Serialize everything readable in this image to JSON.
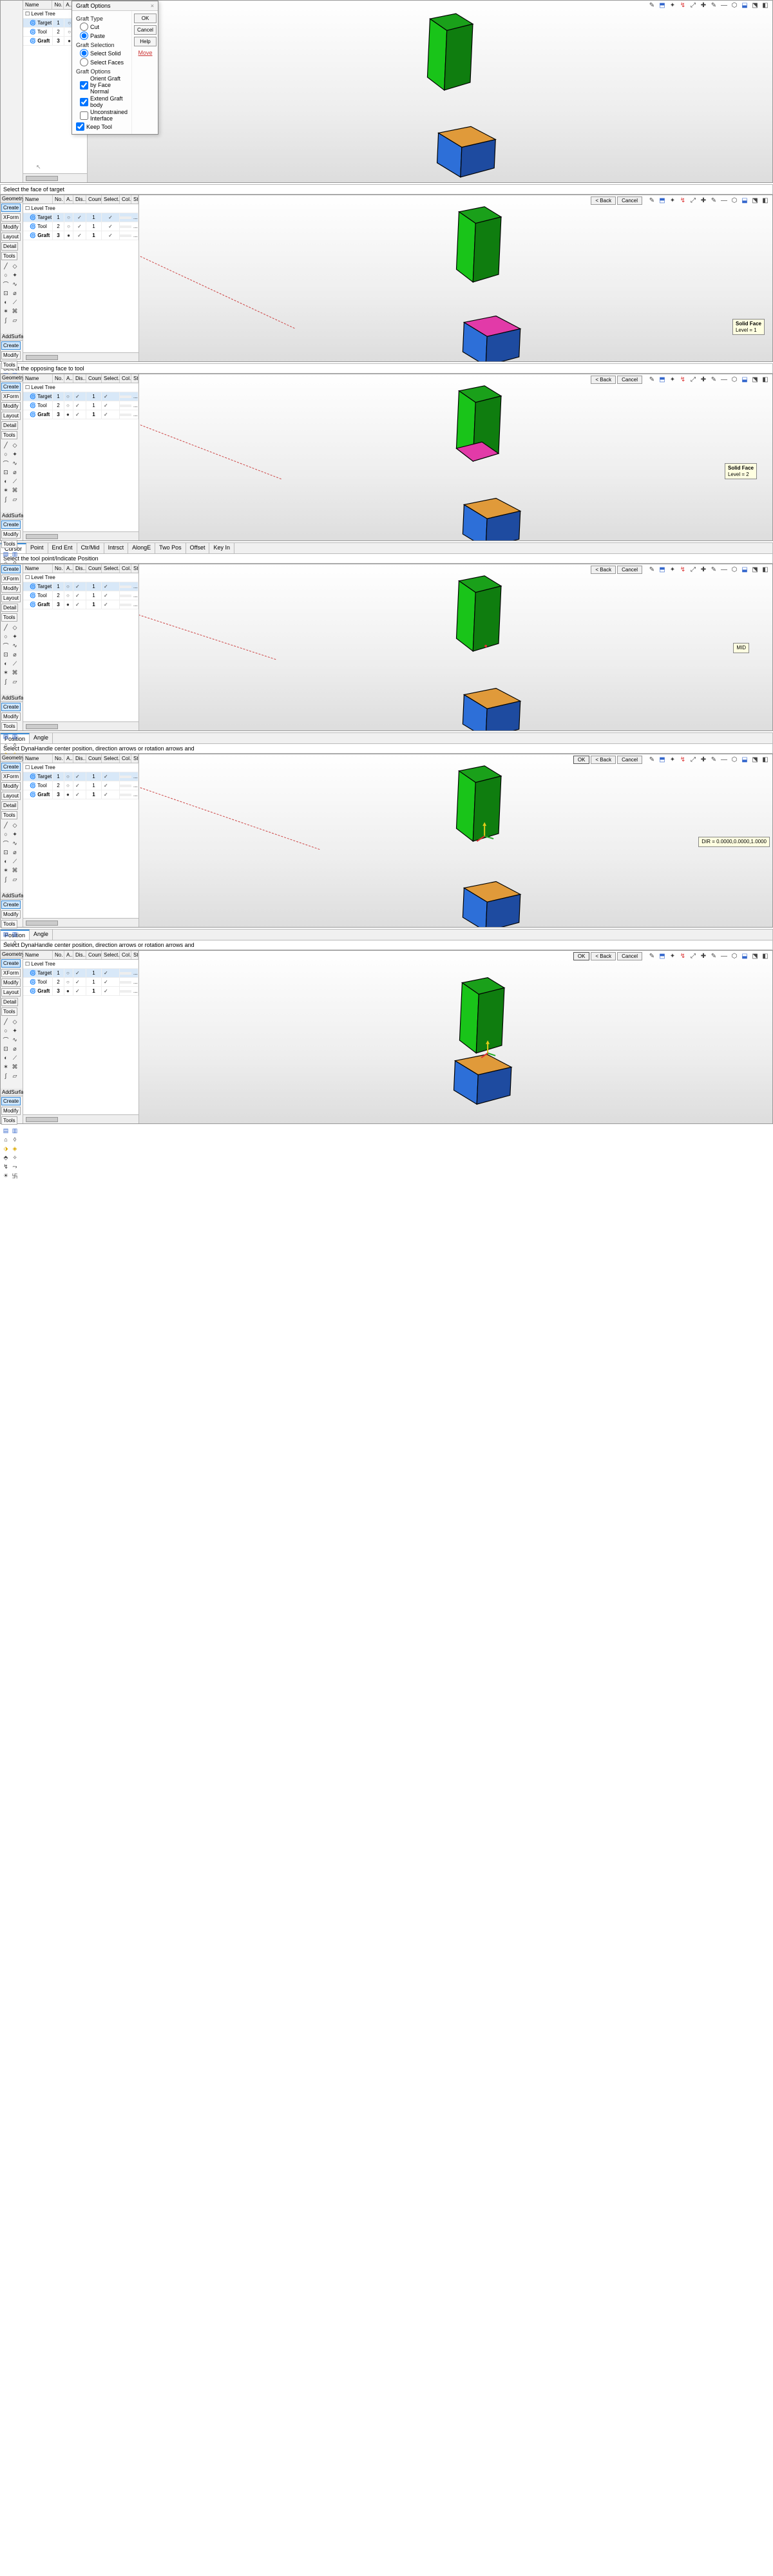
{
  "dialog": {
    "title": "Graft Options",
    "close_x": "×",
    "ok": "OK",
    "cancel": "Cancel",
    "help": "Help",
    "move": "Move",
    "graft_type_label": "Graft Type",
    "type_cut": "Cut",
    "type_paste": "Paste",
    "graft_selection_label": "Graft Selection",
    "sel_solid": "Select Solid",
    "sel_faces": "Select Faces",
    "graft_options_label": "Graft Options",
    "opt_orient": "Orient Graft by Face Normal",
    "opt_extend": "Extend Graft body",
    "opt_uncon": "Unconstrained Interface",
    "opt_keep": "Keep Tool"
  },
  "tree": {
    "headers": [
      "Name",
      "No.",
      "A..",
      "Dis..",
      "Count",
      "Select..",
      "Col..",
      "Style"
    ],
    "root": "Level Tree",
    "rows": [
      {
        "name": "Target",
        "no": "1",
        "a": "○",
        "dis": "✓",
        "count": "1",
        "sel": "✓",
        "col": "",
        "style": "..."
      },
      {
        "name": "Tool",
        "no": "2",
        "a": "○",
        "dis": "✓",
        "count": "1",
        "sel": "✓",
        "col": "",
        "style": "..."
      },
      {
        "name": "Graft",
        "no": "3",
        "a": "●",
        "dis": "✓",
        "count": "1",
        "sel": "✓",
        "col": "",
        "style": "..."
      }
    ],
    "headers_short": [
      "Name",
      "No.",
      "A..",
      "Dis.."
    ],
    "rows_short": [
      {
        "name": "Target",
        "no": "1",
        "a": "○",
        "dis": "✓"
      },
      {
        "name": "Tool",
        "no": "2",
        "a": "○",
        "dis": "✓"
      },
      {
        "name": "Graft",
        "no": "3",
        "a": "●",
        "dis": "✓"
      }
    ]
  },
  "palettes": {
    "p1": {
      "title": "Geometry",
      "btns": [
        "Create",
        "XForm",
        "Modify",
        "Layout",
        "Detail",
        "Tools"
      ]
    },
    "p2": {
      "title": "AddSurface",
      "btns": [
        "Create",
        "Modify",
        "Tools"
      ]
    }
  },
  "buttons": {
    "ok": "OK",
    "back": "< Back",
    "cancel": "Cancel"
  },
  "prompts": {
    "p2": "Select the face of target",
    "p3": "Select the opposing face to tool",
    "p4": "Select the tool point/Indicate Position",
    "p5": "Select DynaHandle center position, direction arrows or rotation arrows and",
    "p6": "Select DynaHandle center position, direction arrows or rotation arrows and"
  },
  "tabs": {
    "position": "Position",
    "angle": "Angle",
    "snap": [
      "Cursor",
      "Point",
      "End Ent",
      "Ctr/Mid",
      "Intrsct",
      "AlongE",
      "Two Pos",
      "Offset",
      "Key In"
    ]
  },
  "tooltips": {
    "face1": {
      "title": "Solid Face",
      "line": "Level = 1"
    },
    "face2": {
      "title": "Solid Face",
      "line": "Level = 2"
    },
    "mid": "MID",
    "dir": "DIR = 0.0000,0.0000,1.0000"
  },
  "colors": {
    "green": "#19c419",
    "blue": "#2d6fd8",
    "highlight": "#e23aa8"
  }
}
